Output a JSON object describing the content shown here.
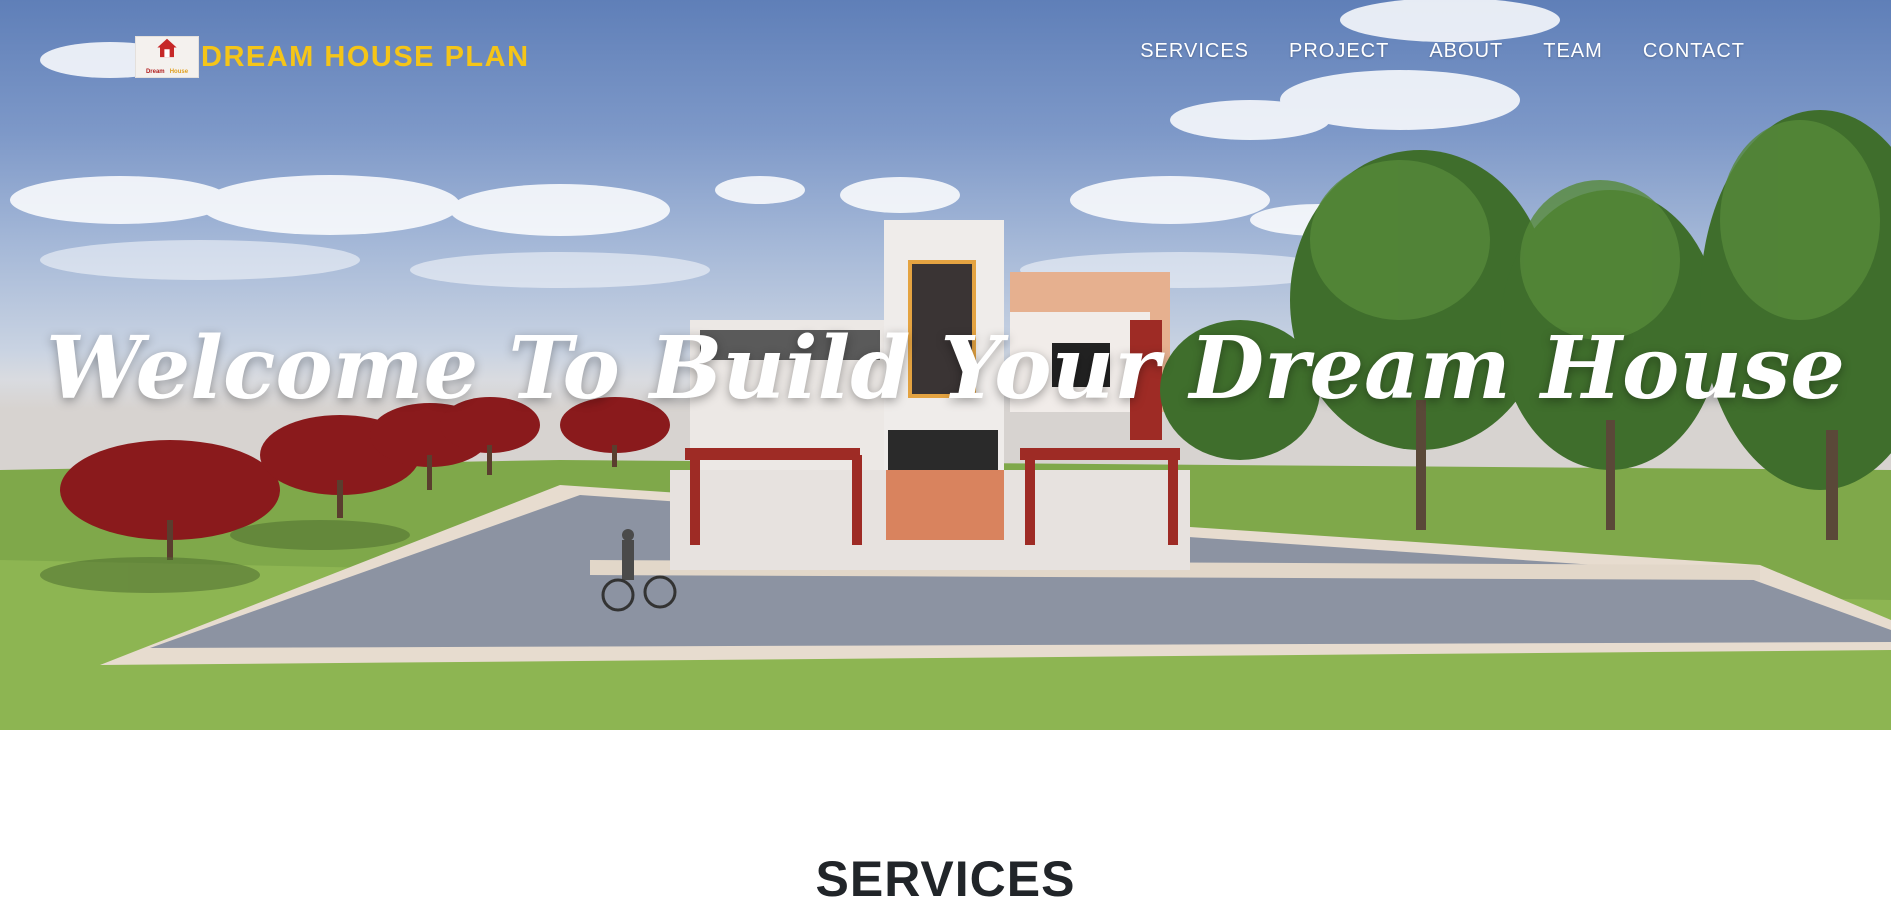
{
  "brand": {
    "logo_text_top": "Dream",
    "logo_text_bottom": "House",
    "name": "DREAM HOUSE PLAN"
  },
  "nav": {
    "items": [
      "SERVICES",
      "PROJECT",
      "ABOUT",
      "TEAM",
      "CONTACT"
    ]
  },
  "hero": {
    "heading": "Welcome To Build Your Dream House"
  },
  "services": {
    "title": "SERVICES"
  },
  "colors": {
    "brand_yellow": "#f5c518",
    "heading_dark": "#212529"
  }
}
